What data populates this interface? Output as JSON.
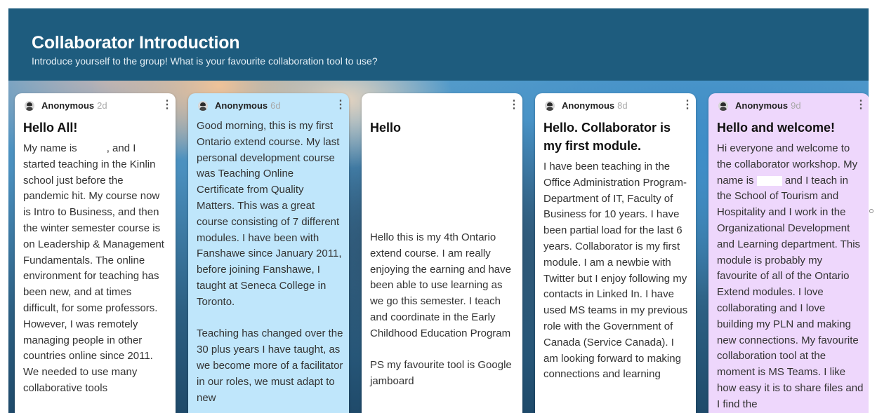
{
  "header": {
    "title": "Collaborator Introduction",
    "subtitle": "Introduce yourself to the group! What is your favourite collaboration tool to use?"
  },
  "colors": {
    "header_bg": "#1e5c7e",
    "post_white": "#ffffff",
    "post_blue": "#bfe6fb",
    "post_purple": "#eed7fc"
  },
  "posts": [
    {
      "author": "Anonymous",
      "age": "2d",
      "title": "Hello All!",
      "color": "white",
      "body": [
        [
          "My name is",
          ", and I started teaching in the Kinlin school just before the pandemic hit. My course now is Intro to Business, and then the winter semester course is on Leadership & Management Fundamentals. The online environment for teaching has been new, and at times difficult, for some professors. However, I was remotely managing people in other countries online since 2011. We needed to use many collaborative tools"
        ]
      ]
    },
    {
      "author": "Anonymous",
      "age": "6d",
      "title": "",
      "color": "blue",
      "body": [
        "Good morning, this is my first Ontario extend course. My last personal development course was Teaching Online Certificate from Quality Matters.  This was a great course consisting of 7 different modules.  I have been with Fanshawe since January 2011, before joining Fanshawe, I taught at Seneca College in Toronto.",
        "Teaching has changed over the 30 plus years I have taught, as we become more of a facilitator in our roles, we must adapt to new"
      ]
    },
    {
      "author": "",
      "age": "",
      "title": "Hello",
      "color": "white",
      "body": [
        "Hello this is my 4th Ontario extend course. I am really enjoying the earning and have been able to use learning as we go this semester. I teach and coordinate in the Early Childhood Education Program",
        "PS my favourite tool is Google jamboard"
      ]
    },
    {
      "author": "Anonymous",
      "age": "8d",
      "title": "Hello. Collaborator is my first module.",
      "color": "white",
      "body": [
        "I have been teaching in the Office Administration Program-  Department of IT, Faculty of Business for 10 years.  I have been partial load for the last 6 years. Collaborator is my first module.  I am a newbie with Twitter but I enjoy following my contacts in Linked In.  I have used MS teams in my previous role with the Government of Canada (Service Canada).  I am looking forward to making connections and learning"
      ]
    },
    {
      "author": "Anonymous",
      "age": "9d",
      "title": "Hello and welcome!",
      "color": "purple",
      "body": [
        [
          "Hi everyone and welcome to the collaborator workshop. My name is",
          "and I teach in the School of Tourism and Hospitality and I work in the Organizational Development and Learning department. This module is probably my favourite of all of the Ontario Extend modules.  I love collaborating and I love building my PLN and making new connections.  My favourite collaboration tool at the moment is MS Teams.  I like how easy it is to share files and I find the"
        ]
      ]
    }
  ]
}
